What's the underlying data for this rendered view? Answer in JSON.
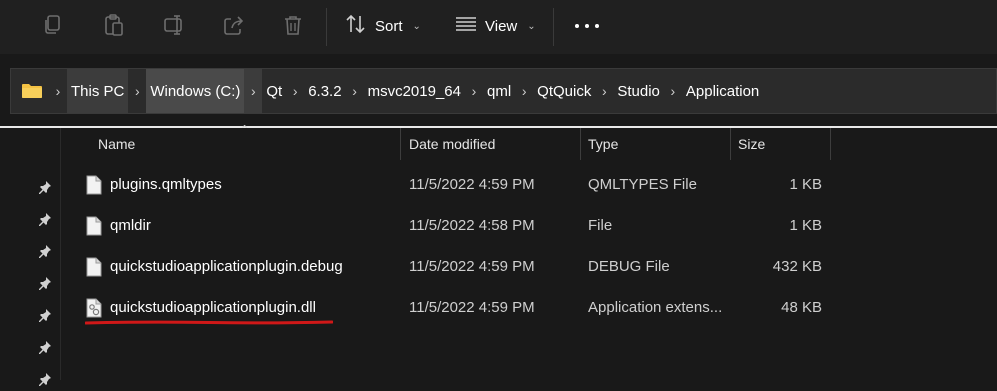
{
  "toolbar": {
    "sort_label": "Sort",
    "view_label": "View",
    "icons": [
      "copy-icon",
      "paste-icon",
      "rename-icon",
      "share-icon",
      "delete-icon",
      "sort-icon",
      "view-icon",
      "more-icon"
    ]
  },
  "address": {
    "crumbs": [
      "This PC",
      "Windows (C:)",
      "Qt",
      "6.3.2",
      "msvc2019_64",
      "qml",
      "QtQuick",
      "Studio",
      "Application"
    ]
  },
  "columns": {
    "name": "Name",
    "date": "Date modified",
    "type": "Type",
    "size": "Size"
  },
  "files": [
    {
      "name": "plugins.qmltypes",
      "date": "11/5/2022 4:59 PM",
      "type": "QMLTYPES File",
      "size": "1 KB",
      "icon": "document-icon"
    },
    {
      "name": "qmldir",
      "date": "11/5/2022 4:58 PM",
      "type": "File",
      "size": "1 KB",
      "icon": "document-icon"
    },
    {
      "name": "quickstudioapplicationplugin.debug",
      "date": "11/5/2022 4:59 PM",
      "type": "DEBUG File",
      "size": "432 KB",
      "icon": "document-icon"
    },
    {
      "name": "quickstudioapplicationplugin.dll",
      "date": "11/5/2022 4:59 PM",
      "type": "Application extens...",
      "size": "48 KB",
      "icon": "dll-gear-icon"
    }
  ],
  "colors": {
    "background": "#191919",
    "toolbar": "#202020",
    "folder": "#f4c243",
    "highlight_underline": "#d01818"
  }
}
